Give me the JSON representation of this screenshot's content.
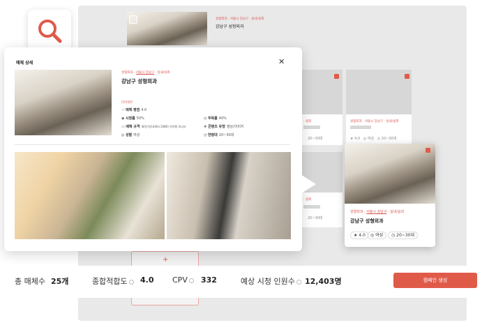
{
  "colors": {
    "accent": "#e05a4a",
    "background_panel": "#e9e9e9"
  },
  "icons": {
    "search": "search-icon",
    "close": "close-icon",
    "star": "star-icon",
    "info": "info-icon",
    "pin": "map-pin-icon"
  },
  "modal": {
    "title": "매체 상세",
    "breadcrumb": [
      "성형외과",
      "서울시 강남구",
      "실내/실외"
    ],
    "name": "강남구 성형외과",
    "section_tag": "다이렉트",
    "attrs_left": [
      {
        "key": "매체 평점",
        "val": "4.0"
      },
      {
        "key": "시청률",
        "val": "50%"
      },
      {
        "key": "매체 규격",
        "val": "40인치(1440×1080) 가로형 모니터"
      },
      {
        "key": "성별",
        "val": "여성"
      }
    ],
    "attrs_right": [
      {
        "key": "주목률",
        "val": "40%"
      },
      {
        "key": "콘텐츠 유형",
        "val": "영상/이미지"
      },
      {
        "key": "연령대",
        "val": "20~30대"
      }
    ]
  },
  "back_card": {
    "breadcrumb": "성형외과 · 서울시 강남구 · 실내/실외",
    "name": "강남구 성형외과"
  },
  "mini_cards": [
    {
      "tag": "· 실외",
      "age": "20~30대"
    },
    {
      "tag": "· 실외",
      "age": "20~30대"
    }
  ],
  "hover_card": {
    "breadcrumb": [
      "성형외과",
      "서울시 강남구",
      "실내/실외"
    ],
    "name": "강남구 성형외과",
    "rating": "4.0",
    "gender": "여성",
    "age": "20~30대"
  },
  "bottom": {
    "total_label": "총 매체수",
    "total_val": "25개",
    "fit_label": "종합적합도",
    "fit_val": "4.0",
    "cpv_label": "CPV",
    "cpv_val": "332",
    "viewers_label": "예상 시청 인원수",
    "viewers_val": "12,403명",
    "campaign_button": "캠페인 생성"
  }
}
